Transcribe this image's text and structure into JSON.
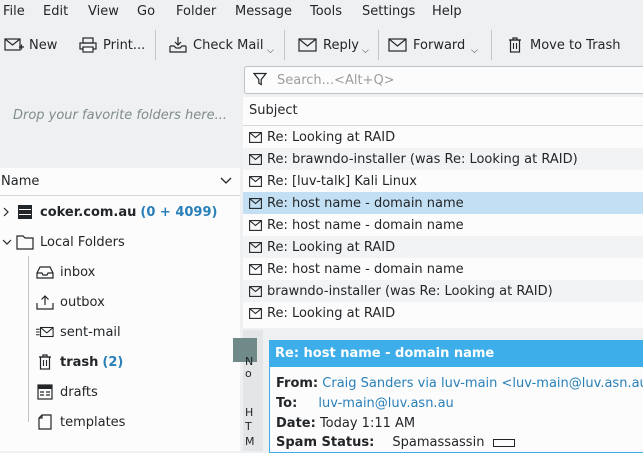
{
  "menu": [
    "File",
    "Edit",
    "View",
    "Go",
    "Folder",
    "Message",
    "Tools",
    "Settings",
    "Help"
  ],
  "toolbar": {
    "new": "New",
    "print": "Print...",
    "check_mail": "Check Mail",
    "reply": "Reply",
    "forward": "Forward",
    "trash": "Move to Trash"
  },
  "favorites": {
    "placeholder": "Drop your favorite folders here..."
  },
  "folders": {
    "header": "Name",
    "account": {
      "name": "coker.com.au",
      "count": "(0 + 4099)"
    },
    "local": "Local Folders",
    "items": [
      {
        "label": "inbox",
        "count": ""
      },
      {
        "label": "outbox",
        "count": ""
      },
      {
        "label": "sent-mail",
        "count": ""
      },
      {
        "label": "trash",
        "count": "(2)"
      },
      {
        "label": "drafts",
        "count": ""
      },
      {
        "label": "templates",
        "count": ""
      }
    ]
  },
  "search": {
    "placeholder": "Search...<Alt+Q>"
  },
  "messages": {
    "header": "Subject",
    "rows": [
      "Re: Looking at RAID",
      "Re: brawndo-installer (was Re: Looking at RAID)",
      "Re: [luv-talk] Kali Linux",
      "Re: host name - domain name",
      "Re: host name - domain name",
      "Re: Looking at RAID",
      "Re: host name - domain name",
      "brawndo-installer (was Re: Looking at RAID)",
      "Re: Looking at RAID"
    ],
    "selected_index": 3
  },
  "reader": {
    "side_text": [
      "N",
      "o",
      "H",
      "T",
      "M"
    ],
    "title": "Re: host name - domain name",
    "from_label": "From:",
    "from_value": "Craig Sanders via luv-main <luv-main@luv.asn.au>",
    "to_label": "To:",
    "to_value": "luv-main@luv.asn.au",
    "date_label": "Date:",
    "date_value": "Today 1:11 AM",
    "spam_label": "Spam Status:",
    "spam_value": "Spamassassin"
  },
  "colors": {
    "accent": "#3daee9",
    "link": "#2980b9",
    "selection": "#c2dff3"
  }
}
